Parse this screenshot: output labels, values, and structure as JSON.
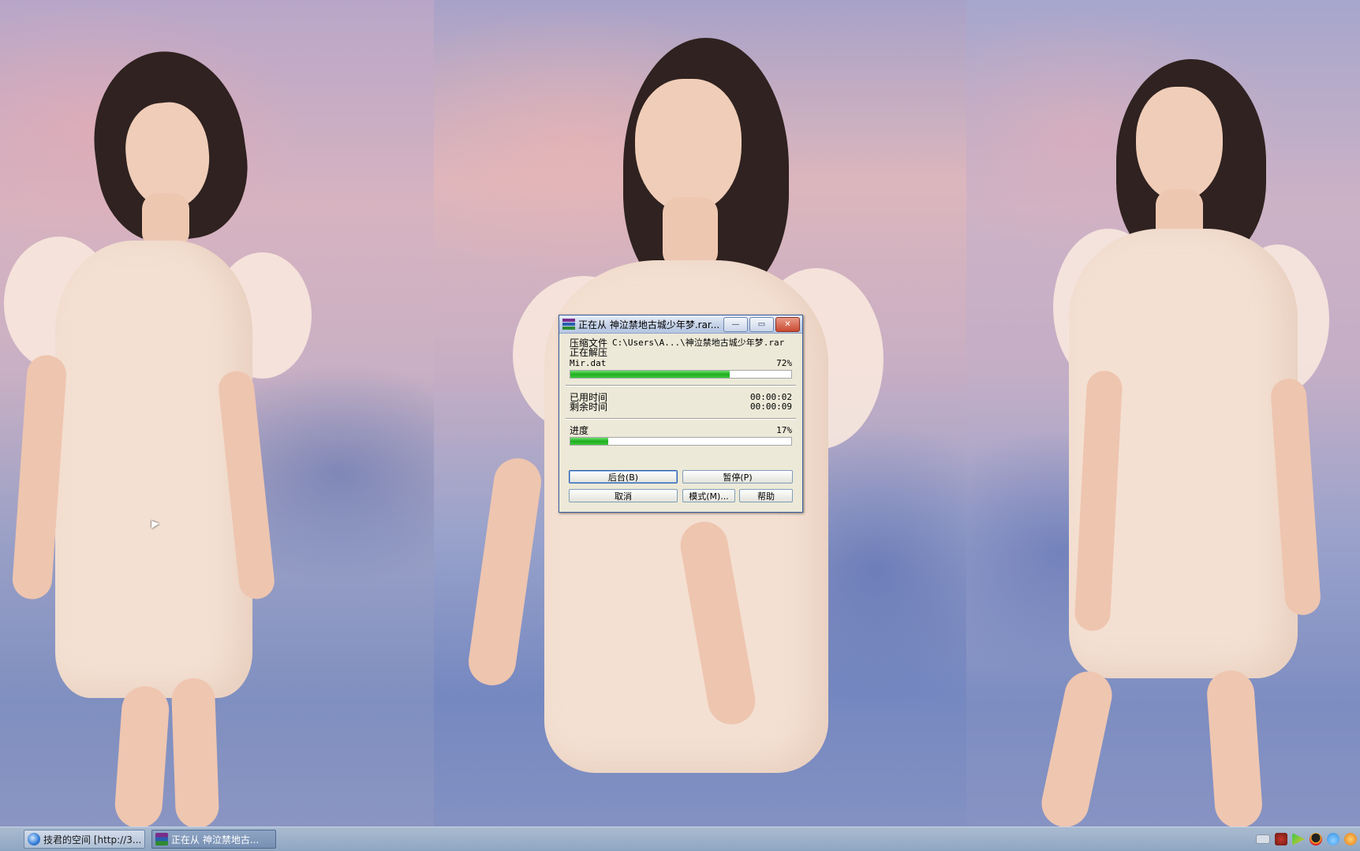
{
  "dialog": {
    "title": "正在从 神泣禁地古城少年梦.rar...",
    "archive_label": "压缩文件",
    "archive_path": "C:\\Users\\A...\\神泣禁地古城少年梦.rar",
    "status": "正在解压",
    "current_file": "Mir.dat",
    "file_percent_text": "72%",
    "file_progress": 72,
    "elapsed_label": "已用时间",
    "elapsed_value": "00:00:02",
    "remaining_label": "剩余时间",
    "remaining_value": "00:00:09",
    "overall_label": "进度",
    "overall_percent_text": "17%",
    "overall_progress": 17,
    "buttons": {
      "background": "后台(B)",
      "pause": "暂停(P)",
      "cancel": "取消",
      "mode": "模式(M)...",
      "help": "帮助"
    },
    "window_buttons": {
      "minimize": "—",
      "maximize": "▭",
      "close": "✕"
    }
  },
  "taskbar": {
    "tasks": [
      {
        "label": "技君的空间 [http://3...",
        "icon": "ie-icon"
      },
      {
        "label": "正在从 神泣禁地古...",
        "icon": "winrar-icon"
      }
    ],
    "tray_icons": [
      "keyboard-icon",
      "security-icon",
      "media-icon",
      "qq-icon",
      "cloud-icon",
      "update-icon"
    ]
  }
}
